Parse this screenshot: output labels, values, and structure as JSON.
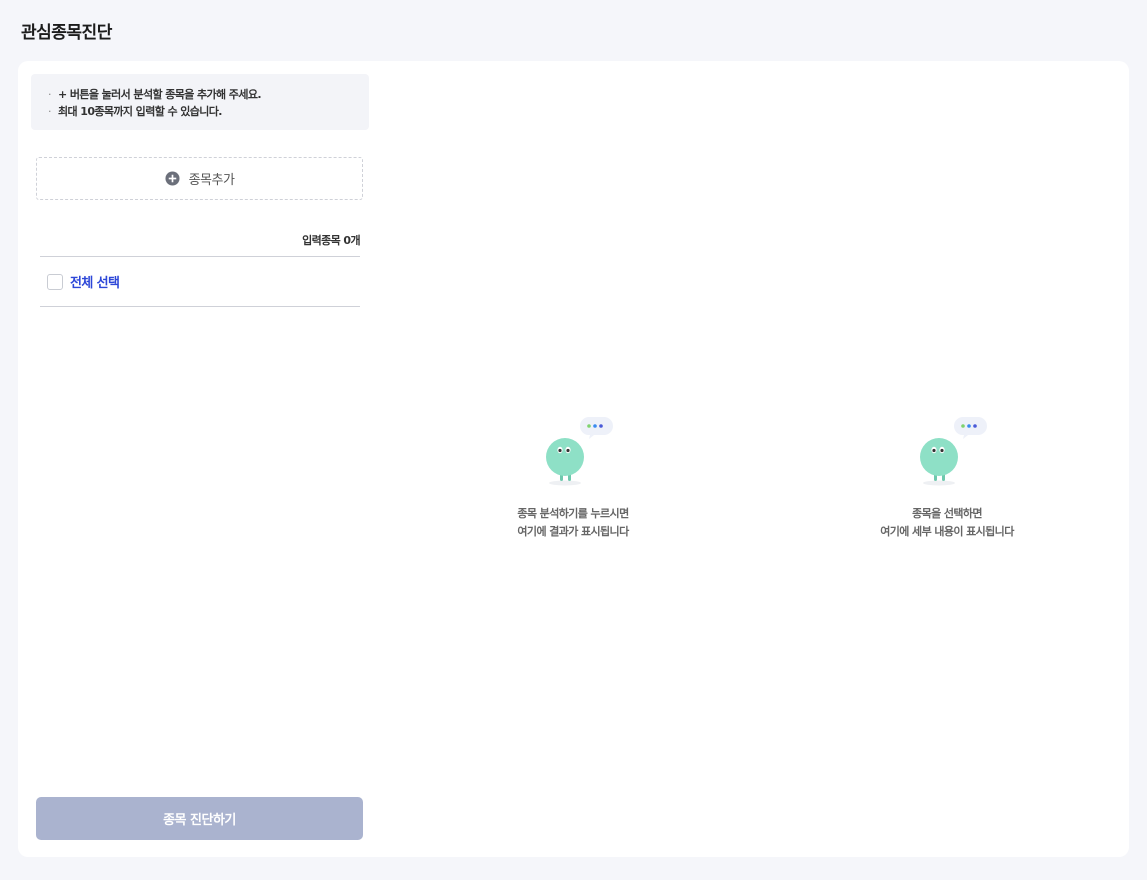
{
  "page": {
    "title": "관심종목진단"
  },
  "notice": {
    "lines": [
      "+ 버튼을 눌러서 분석할 종목을 추가해 주세요.",
      "최대 10종목까지 입력할 수 있습니다."
    ]
  },
  "add_button": {
    "label": "종목추가",
    "icon": "plus-circle-icon"
  },
  "stock_list": {
    "count_label": "입력종목 0개",
    "select_all_label": "전체 선택",
    "select_all_checked": false
  },
  "diagnose_button": {
    "label": "종목 진단하기",
    "enabled": false
  },
  "result_panel": {
    "line1": "종목 분석하기를 누르시면",
    "line2": "여기에 결과가 표시됩니다",
    "illustration": "character-speech-bubble-icon"
  },
  "detail_panel": {
    "line1": "종목을 선택하면",
    "line2": "여기에 세부 내용이 표시됩니다",
    "illustration": "character-speech-bubble-icon"
  },
  "colors": {
    "background": "#f5f6fa",
    "card": "#ffffff",
    "accent_blue": "#2d47d8",
    "disabled_button": "#aab3cf",
    "character_mint": "#8ee0c6"
  }
}
